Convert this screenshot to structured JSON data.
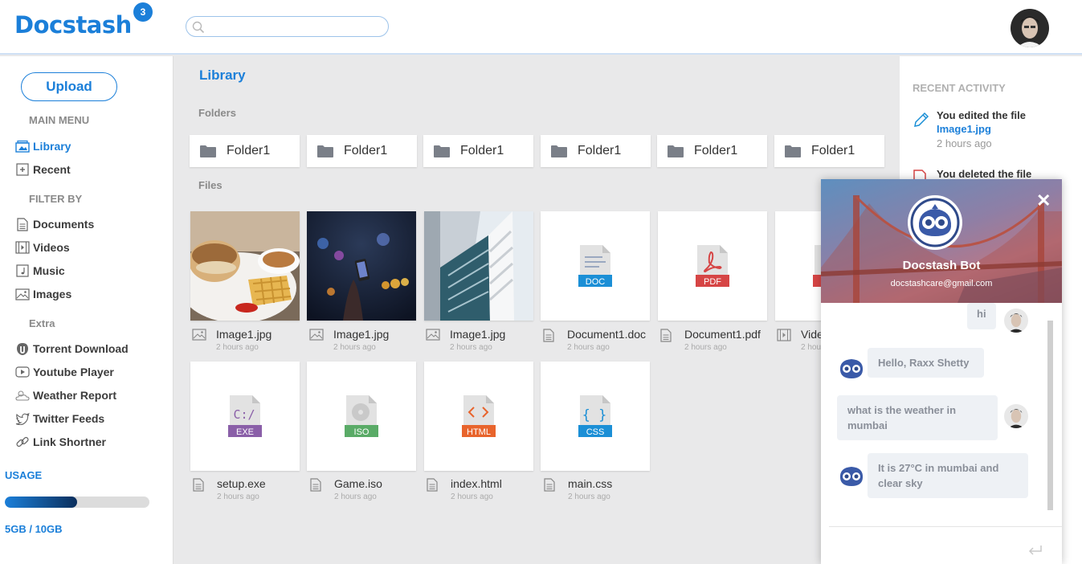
{
  "header": {
    "logo": "Docstash",
    "notification_count": "3",
    "search_placeholder": ""
  },
  "sidebar": {
    "upload_label": "Upload",
    "main_menu_label": "MAIN MENU",
    "main_menu": [
      {
        "label": "Library",
        "icon": "library-icon",
        "active": true
      },
      {
        "label": "Recent",
        "icon": "recent-icon",
        "active": false
      }
    ],
    "filter_label": "FILTER BY",
    "filters": [
      {
        "label": "Documents",
        "icon": "document-icon"
      },
      {
        "label": "Videos",
        "icon": "video-icon"
      },
      {
        "label": "Music",
        "icon": "music-icon"
      },
      {
        "label": "Images",
        "icon": "image-icon"
      }
    ],
    "extra_label": "Extra",
    "extras": [
      {
        "label": "Torrent Download",
        "icon": "torrent-icon"
      },
      {
        "label": "Youtube Player",
        "icon": "youtube-icon"
      },
      {
        "label": "Weather Report",
        "icon": "weather-icon"
      },
      {
        "label": "Twitter Feeds",
        "icon": "twitter-icon"
      },
      {
        "label": "Link Shortner",
        "icon": "link-icon"
      }
    ],
    "usage_label": "USAGE",
    "usage_fraction": 0.5,
    "usage_text": "5GB / 10GB"
  },
  "main": {
    "title": "Library",
    "folders_label": "Folders",
    "folders": [
      "Folder1",
      "Folder1",
      "Folder1",
      "Folder1",
      "Folder1",
      "Folder1"
    ],
    "files_label": "Files",
    "files": [
      {
        "name": "Image1.jpg",
        "time": "2 hours ago",
        "kind": "image",
        "thumb": "food-photo"
      },
      {
        "name": "Image1.jpg",
        "time": "2 hours ago",
        "kind": "image",
        "thumb": "city-night-photo"
      },
      {
        "name": "Image1.jpg",
        "time": "2 hours ago",
        "kind": "image",
        "thumb": "building-photo"
      },
      {
        "name": "Document1.doc",
        "time": "2 hours ago",
        "kind": "doc",
        "badge": "DOC",
        "color": "#1b8fd6"
      },
      {
        "name": "Document1.pdf",
        "time": "2 hours ago",
        "kind": "pdf",
        "badge": "PDF",
        "color": "#d64545"
      },
      {
        "name": "Vide",
        "time": "2 hou",
        "kind": "video",
        "badge": "",
        "color": "#d64545"
      },
      {
        "name": "setup.exe",
        "time": "2 hours ago",
        "kind": "exe",
        "badge": "EXE",
        "color": "#8a5fa8"
      },
      {
        "name": "Game.iso",
        "time": "2 hours ago",
        "kind": "iso",
        "badge": "ISO",
        "color": "#5aab67"
      },
      {
        "name": "index.html",
        "time": "2 hours ago",
        "kind": "html",
        "badge": "HTML",
        "color": "#e8642c"
      },
      {
        "name": "main.css",
        "time": "2 hours ago",
        "kind": "css",
        "badge": "CSS",
        "color": "#1b8fd6"
      }
    ]
  },
  "activity": {
    "title": "RECENT ACTIVITY",
    "items": [
      {
        "action": "You edited the file",
        "file": "Image1.jpg",
        "time": "2 hours ago",
        "icon": "pencil-icon"
      },
      {
        "action": "You deleted the file",
        "file": "",
        "time": "",
        "icon": "delete-file-icon"
      }
    ]
  },
  "chat": {
    "bot_name": "Docstash Bot",
    "bot_email": "docstashcare@gmail.com",
    "messages": [
      {
        "from": "user",
        "text": "hi"
      },
      {
        "from": "bot",
        "text": "Hello, Raxx Shetty"
      },
      {
        "from": "user",
        "text": "what is the weather in mumbai"
      },
      {
        "from": "bot",
        "text": "It is 27°C in mumbai and clear sky"
      }
    ],
    "input_placeholder": ""
  },
  "colors": {
    "accent": "#1b7fd9",
    "background": "#e9e9ea"
  }
}
